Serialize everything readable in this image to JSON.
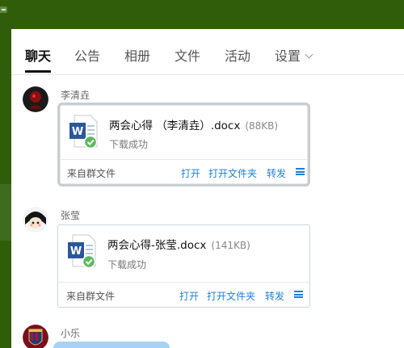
{
  "tabs": [
    "聊天",
    "公告",
    "相册",
    "文件",
    "活动",
    "设置"
  ],
  "messages": [
    {
      "sender": "李清垚",
      "file": {
        "name": "两会心得 （李清垚）.docx",
        "size": "(88KB)",
        "status": "下载成功"
      },
      "source": "来自群文件",
      "actions": {
        "open": "打开",
        "open_folder": "打开文件夹",
        "forward": "转发"
      }
    },
    {
      "sender": "张莹",
      "file": {
        "name": "两会心得-张莹.docx",
        "size": "(141KB)",
        "status": "下载成功"
      },
      "source": "来自群文件",
      "actions": {
        "open": "打开",
        "open_folder": "打开文件夹",
        "forward": "转发"
      }
    },
    {
      "sender": "小乐"
    }
  ],
  "icons": {
    "word_file": "word-document-icon",
    "success": "green-check-icon",
    "menu": "hamburger-menu-icon",
    "settings_dropdown": "chevron-down-icon"
  },
  "colors": {
    "frame_green": "#2f5d0a",
    "link_blue": "#1e7fd8",
    "word_blue": "#2b579a",
    "success_green": "#5cb85c"
  }
}
